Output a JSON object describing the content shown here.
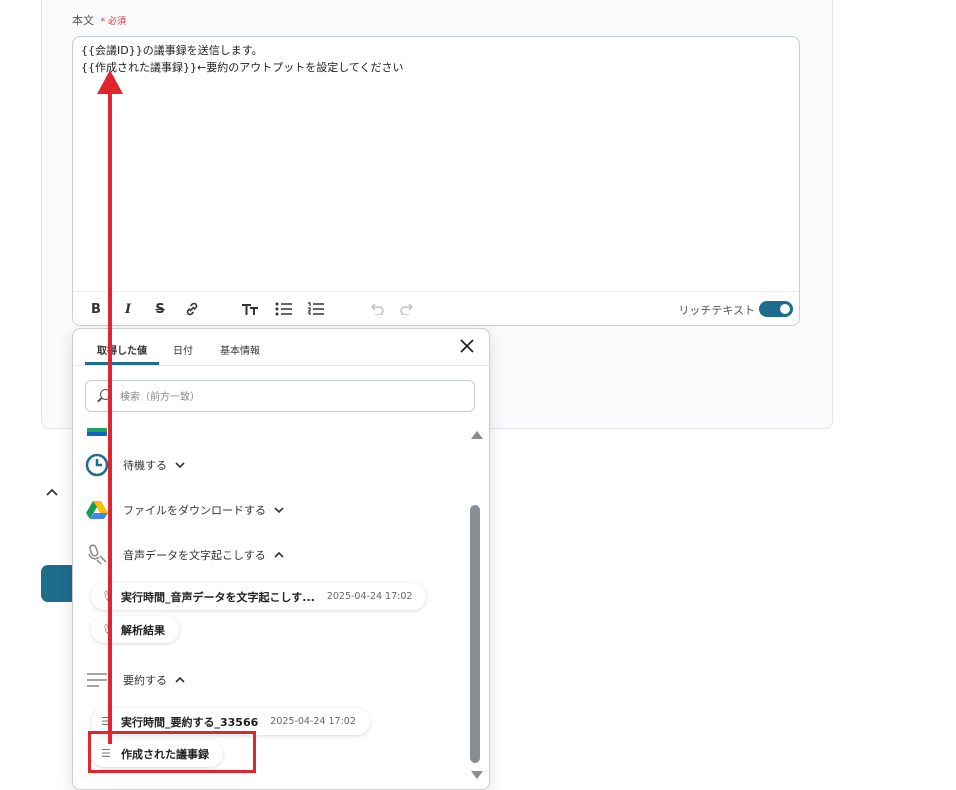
{
  "form": {
    "field_label": "本文",
    "required_mark": "*",
    "required_text": "必須",
    "body_lines": [
      "{{会議ID}}の議事録を送信します。",
      "{{作成された議事録}}←要約のアウトプットを設定してください"
    ],
    "toolbar": {
      "bold": "B",
      "italic": "I",
      "strike": "S",
      "rich_text_label": "リッチテキスト",
      "rich_text_enabled": true
    }
  },
  "popup": {
    "tabs": [
      {
        "label": "取得した値",
        "active": true
      },
      {
        "label": "日付",
        "active": false
      },
      {
        "label": "基本情報",
        "active": false
      }
    ],
    "search_placeholder": "検索（前方一致）",
    "sections": [
      {
        "label": "待機する",
        "icon": "clock-icon",
        "expanded": false
      },
      {
        "label": "ファイルをダウンロードする",
        "icon": "google-drive-icon",
        "expanded": false
      },
      {
        "label": "音声データを文字起こしする",
        "icon": "microphone-icon",
        "expanded": true
      },
      {
        "label": "要約する",
        "icon": "lines-icon",
        "expanded": true
      }
    ],
    "chips": [
      {
        "title": "実行時間_音声データを文字起こしす...",
        "date": "2025-04-24 17:02"
      },
      {
        "title": "解析結果",
        "date": ""
      },
      {
        "title": "実行時間_要約する_33566",
        "date": "2025-04-24 17:02"
      },
      {
        "title": "作成された議事録",
        "date": ""
      }
    ]
  },
  "colors": {
    "accent": "#1f6c8c",
    "annotation_red": "#e0252f",
    "required_red": "#e0303a"
  }
}
